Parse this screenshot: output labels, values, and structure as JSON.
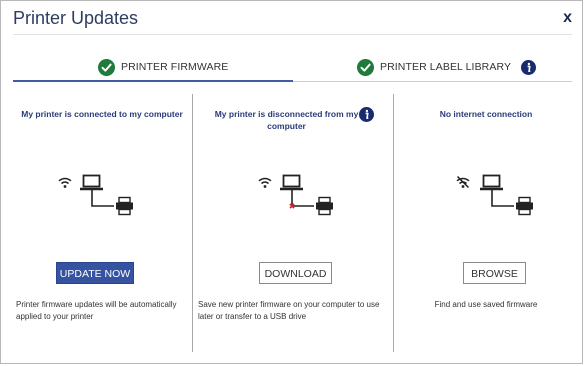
{
  "dialog": {
    "title": "Printer Updates",
    "close_label": "x"
  },
  "tabs": [
    {
      "label": "PRINTER FIRMWARE",
      "icon": "check-circle-icon",
      "active": true
    },
    {
      "label": "PRINTER LABEL LIBRARY",
      "icon": "check-circle-icon",
      "info_icon": "info-icon",
      "active": false
    }
  ],
  "options": [
    {
      "heading": "My printer is connected to my computer",
      "diagram": "connected",
      "button_label": "UPDATE NOW",
      "description": "Printer firmware updates will be automatically applied to your printer"
    },
    {
      "heading": "My printer is disconnected from my computer",
      "diagram": "disconnected",
      "button_label": "DOWNLOAD",
      "description": "Save new printer firmware on your computer to use later or transfer to a USB drive"
    },
    {
      "heading": "No internet connection",
      "diagram": "offline",
      "button_label": "BROWSE",
      "description": "Find and use saved firmware"
    }
  ],
  "colors": {
    "accent": "#3553a0",
    "check": "#1f7a3c",
    "heading": "#2a3b7a",
    "error": "#d9232e"
  }
}
